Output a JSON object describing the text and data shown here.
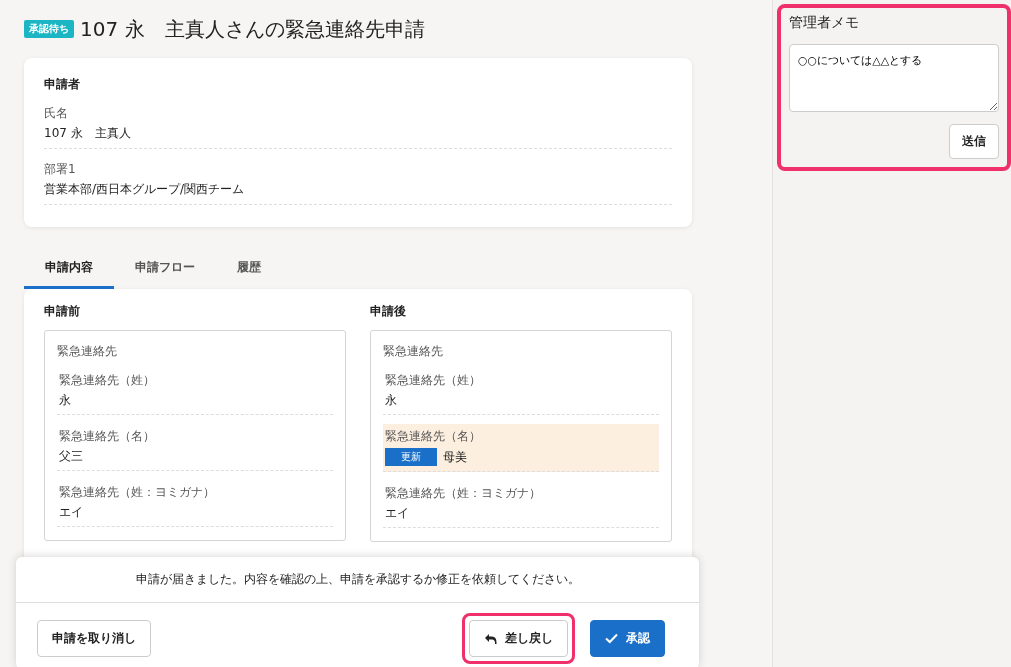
{
  "header": {
    "status_badge": "承認待ち",
    "title": "107 永　主真人さんの緊急連絡先申請"
  },
  "applicant": {
    "heading": "申請者",
    "fields": [
      {
        "label": "氏名",
        "value": "107 永　主真人"
      },
      {
        "label": "部署1",
        "value": "営業本部/西日本グループ/関西チーム"
      }
    ]
  },
  "tabs": [
    {
      "label": "申請内容",
      "selected": true
    },
    {
      "label": "申請フロー",
      "selected": false
    },
    {
      "label": "履歴",
      "selected": false
    }
  ],
  "comparison": [
    {
      "heading": "申請前",
      "group_title": "緊急連絡先",
      "fields": [
        {
          "label": "緊急連絡先（姓）",
          "value": "永",
          "changed": false
        },
        {
          "label": "緊急連絡先（名）",
          "value": "父三",
          "changed": false
        },
        {
          "label": "緊急連絡先（姓：ヨミガナ）",
          "value": "エイ",
          "changed": false
        }
      ]
    },
    {
      "heading": "申請後",
      "group_title": "緊急連絡先",
      "fields": [
        {
          "label": "緊急連絡先（姓）",
          "value": "永",
          "changed": false
        },
        {
          "label": "緊急連絡先（名）",
          "value": "母美",
          "changed": true,
          "badge": "更新"
        },
        {
          "label": "緊急連絡先（姓：ヨミガナ）",
          "value": "エイ",
          "changed": false
        }
      ]
    }
  ],
  "action_bar": {
    "message": "申請が届きました。内容を確認の上、申請を承認するか修正を依頼してください。",
    "buttons": [
      {
        "label": "申請を取り消し",
        "kind": "cancel"
      },
      {
        "label": "差し戻し",
        "kind": "return",
        "highlighted": true
      },
      {
        "label": "承認",
        "kind": "approve"
      }
    ]
  },
  "admin_memo": {
    "title": "管理者メモ",
    "value": "○○については△△とする",
    "submit": "送信",
    "highlighted": true
  }
}
